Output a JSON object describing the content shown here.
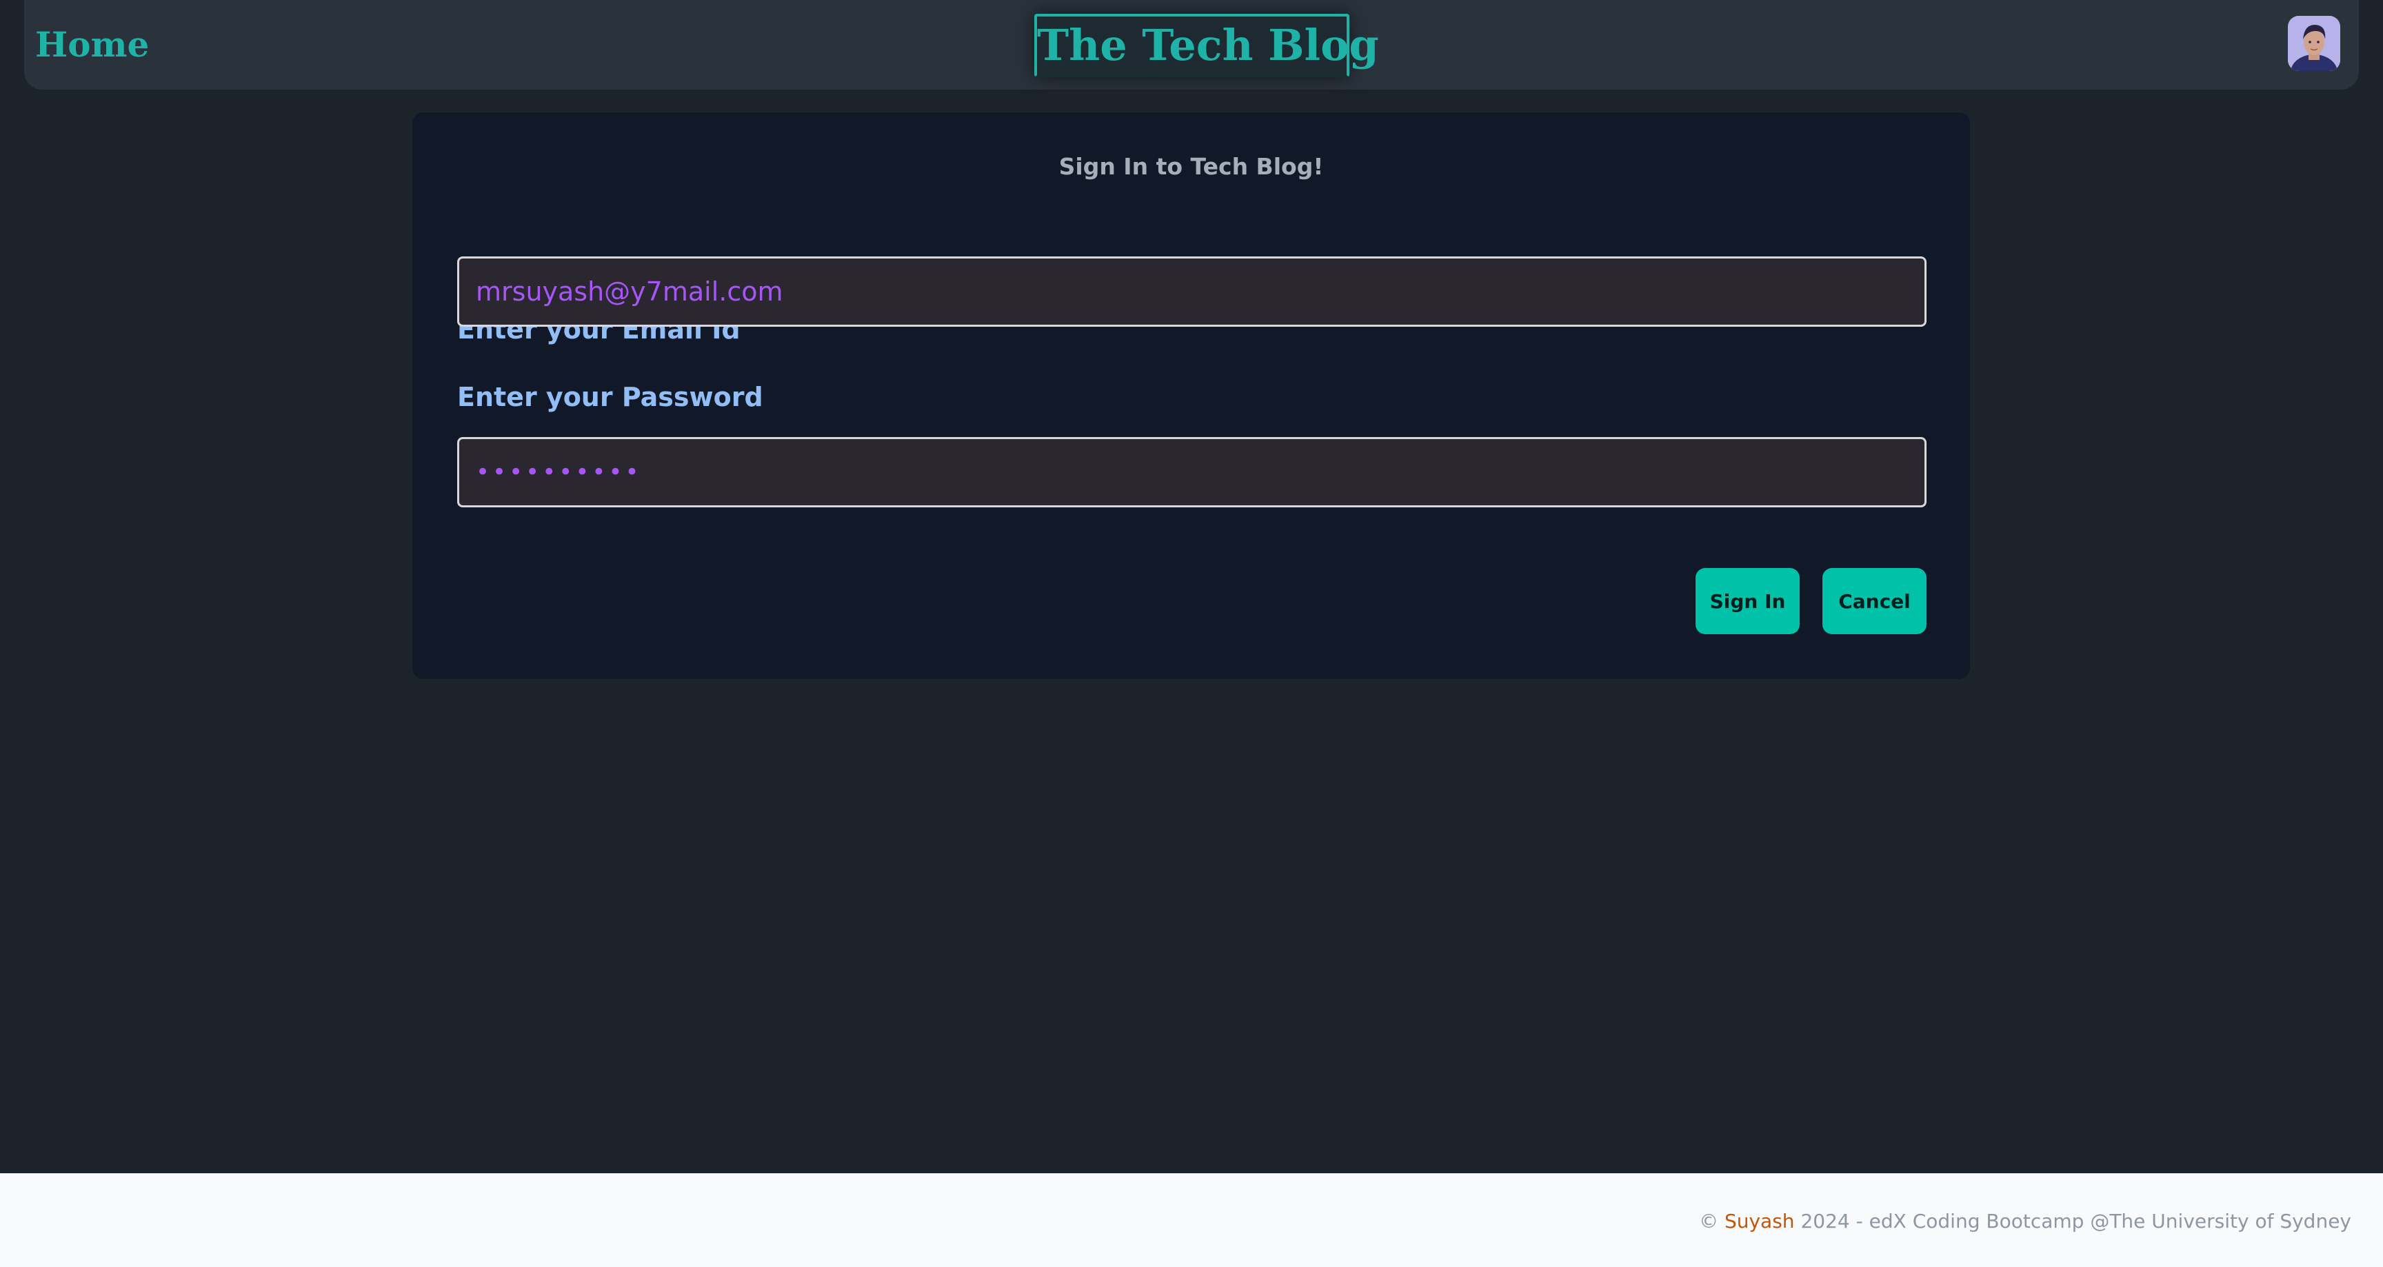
{
  "navbar": {
    "home_label": "Home",
    "brand_label": "The Tech Blog",
    "avatar_alt": "User avatar"
  },
  "login": {
    "title": "Sign In to Tech Blog!",
    "email_label": "Enter your Email Id",
    "email_value": "mrsuyash@y7mail.com",
    "password_label": "Enter your Password",
    "password_value": "••••••••••",
    "signin_label": "Sign In",
    "cancel_label": "Cancel"
  },
  "footer": {
    "copyright_symbol": "©",
    "author": "Suyash",
    "rest": "2024 - edX Coding Bootcamp @The University of Sydney"
  },
  "colors": {
    "page_bg": "#1d232a",
    "navbar_bg": "#2a323c",
    "card_bg": "#111827",
    "accent": "#1fb2a6",
    "button_bg": "#00c2a8",
    "label": "#93bdf5",
    "input_text": "#a855f7",
    "footer_bg": "#f8fafc",
    "footer_author": "#c2570a"
  },
  "icons": {
    "avatar": "avatar-photo"
  }
}
